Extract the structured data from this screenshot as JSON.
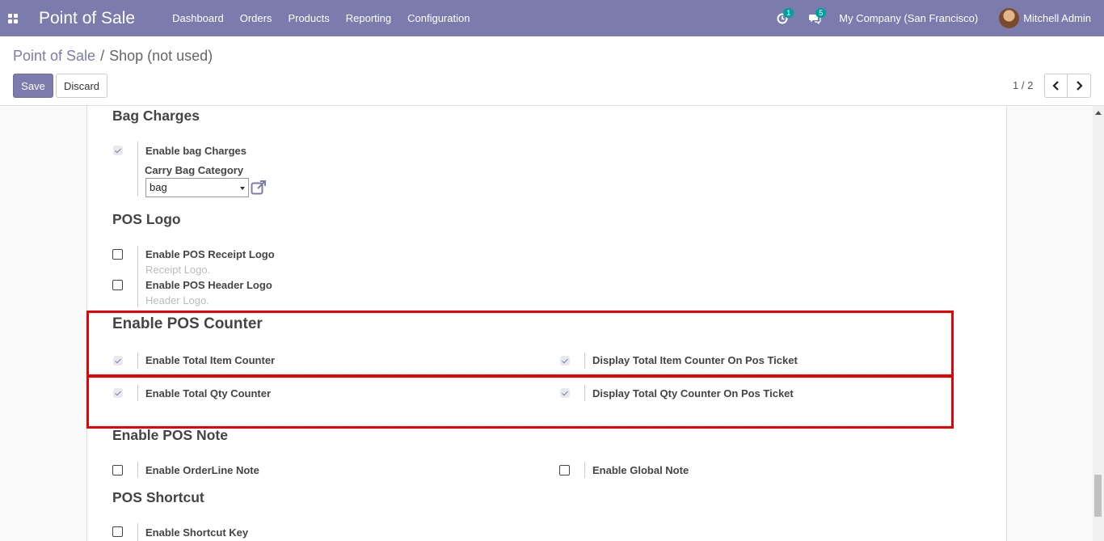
{
  "navbar": {
    "app_title": "Point of Sale",
    "menu": [
      "Dashboard",
      "Orders",
      "Products",
      "Reporting",
      "Configuration"
    ],
    "activity_count": "1",
    "messages_count": "5",
    "company": "My Company (San Francisco)",
    "user": "Mitchell Admin",
    "colors": {
      "bar": "#7c7bad",
      "badge": "#00a09d"
    }
  },
  "control_panel": {
    "breadcrumb_root": "Point of Sale",
    "breadcrumb_sep": "/",
    "breadcrumb_current": "Shop (not used)",
    "save_label": "Save",
    "discard_label": "Discard",
    "pager": "1 / 2"
  },
  "sections": {
    "bag": {
      "title": "Bag Charges",
      "enable_label": "Enable bag Charges",
      "enable_checked": true,
      "category_label": "Carry Bag Category",
      "category_value": "bag"
    },
    "logo": {
      "title": "POS Logo",
      "receipt_label": "Enable POS Receipt Logo",
      "receipt_checked": false,
      "receipt_hint": "Receipt Logo.",
      "header_label": "Enable POS Header Logo",
      "header_checked": false,
      "header_hint": "Header Logo."
    },
    "counter": {
      "title": "Enable POS Counter",
      "total_item_label": "Enable Total Item Counter",
      "display_item_label": "Display Total Item Counter On Pos Ticket",
      "total_qty_label": "Enable Total Qty Counter",
      "display_qty_label": "Display Total Qty Counter On Pos Ticket"
    },
    "note": {
      "title": "Enable POS Note",
      "orderline_label": "Enable OrderLine Note",
      "global_label": "Enable Global Note"
    },
    "shortcut": {
      "title": "POS Shortcut",
      "key_label": "Enable Shortcut Key"
    }
  },
  "highlight_color": "#e00000"
}
